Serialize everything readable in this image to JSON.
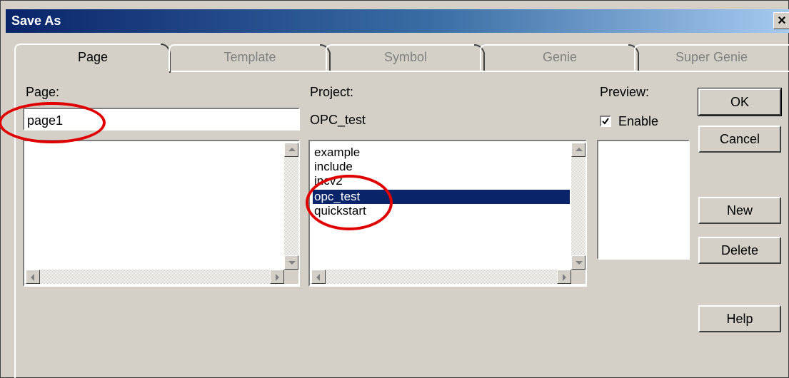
{
  "window": {
    "title": "Save As",
    "close_glyph": "×"
  },
  "tabs": [
    {
      "label": "Page",
      "active": true
    },
    {
      "label": "Template",
      "active": false
    },
    {
      "label": "Symbol",
      "active": false
    },
    {
      "label": "Genie",
      "active": false
    },
    {
      "label": "Super Genie",
      "active": false
    }
  ],
  "page": {
    "label": "Page:",
    "value": "page1"
  },
  "project": {
    "label": "Project:",
    "current": "OPC_test",
    "items": [
      "example",
      "include",
      "incv2",
      "opc_test",
      "quickstart"
    ],
    "selected_index": 3
  },
  "preview": {
    "label": "Preview:",
    "enable_label": "Enable",
    "enabled": true
  },
  "buttons": {
    "ok": "OK",
    "cancel": "Cancel",
    "new": "New",
    "delete": "Delete",
    "help": "Help"
  },
  "annotation_color": "#e00000",
  "selection_color": "#0a246a"
}
